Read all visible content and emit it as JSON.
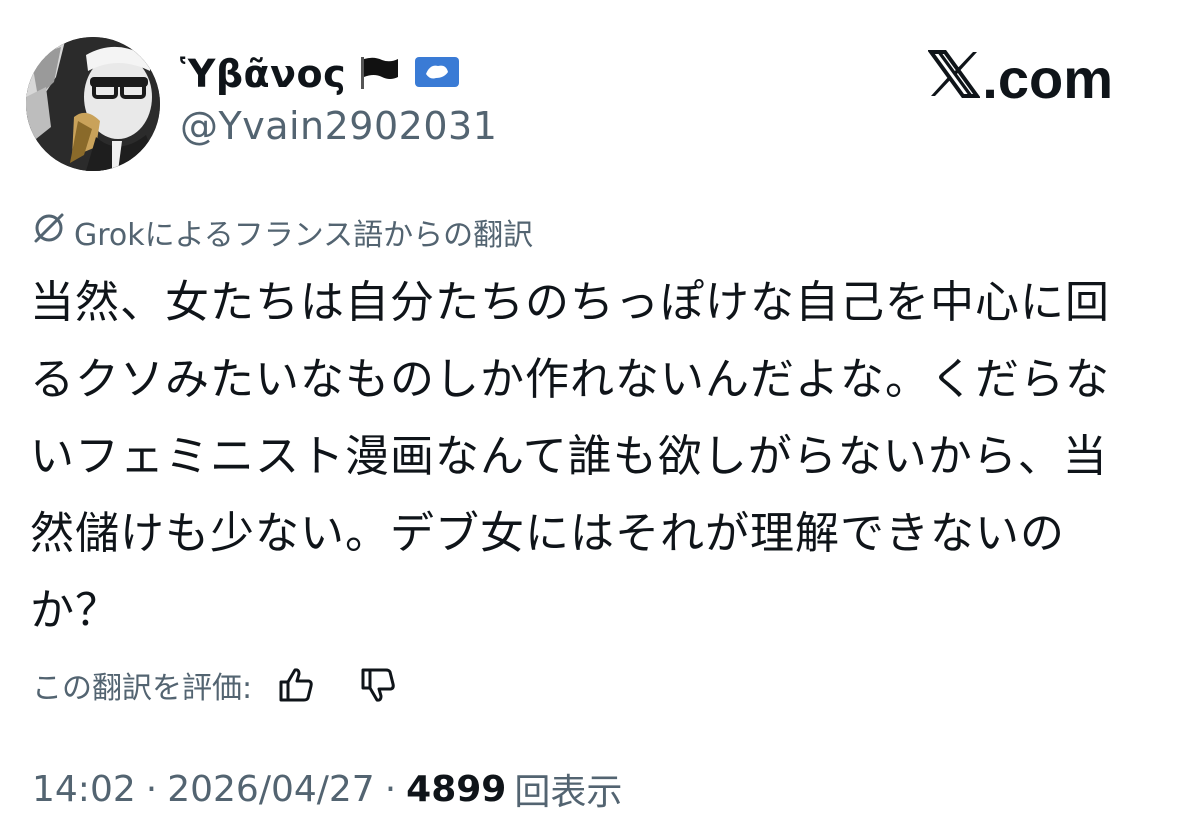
{
  "author": {
    "display_name": "Ὑβᾶνος",
    "handle": "@Yvain2902031",
    "flags": [
      "black-flag-icon",
      "antarctica-flag-icon"
    ]
  },
  "brand": {
    "logo": "x-logo-icon",
    "suffix": ".com"
  },
  "translation": {
    "icon": "grok-icon",
    "label": "Grokによるフランス語からの翻訳"
  },
  "tweet": {
    "text": "当然、女たちは自分たちのちっぽけな自己を中心に回るクソみたいなものしか作れないんだよな。くだらないフェミニスト漫画なんて誰も欲しがらないから、当然儲けも少ない。デブ女にはそれが理解できないのか？"
  },
  "rating": {
    "label": "この翻訳を評価:",
    "up_icon": "thumbs-up-icon",
    "down_icon": "thumbs-down-icon"
  },
  "meta": {
    "time": "14:02",
    "separator": "·",
    "date": "2026/04/27",
    "views_count": "4899",
    "views_label": "回表示"
  },
  "colors": {
    "text_primary": "#0f1419",
    "text_secondary": "#536471",
    "background": "#ffffff"
  }
}
